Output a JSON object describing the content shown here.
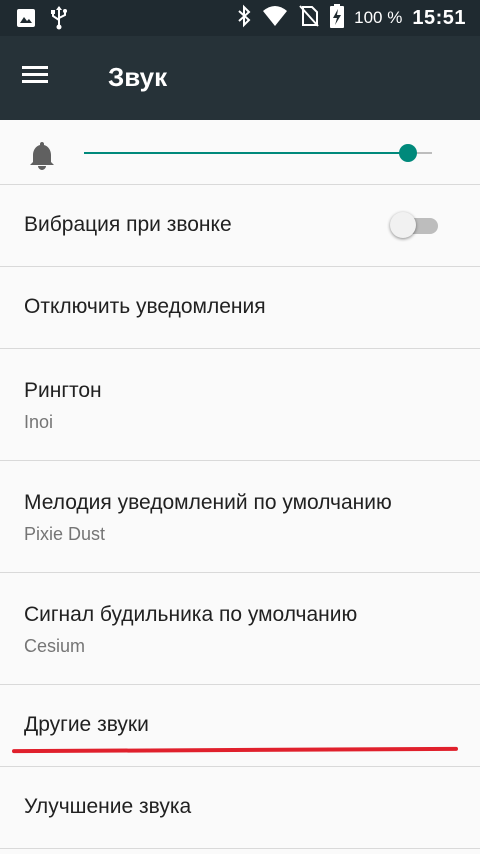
{
  "status_bar": {
    "battery_percent": "100 %",
    "time": "15:51",
    "icons": [
      "image-icon",
      "usb-icon",
      "bluetooth-icon",
      "wifi-icon",
      "no-sim-icon",
      "battery-charging-icon"
    ]
  },
  "toolbar": {
    "menu_icon": "menu-icon",
    "title": "Звук"
  },
  "volume": {
    "icon": "bell-icon",
    "level": 0.93,
    "accent_color": "#00897b"
  },
  "settings": [
    {
      "title": "Вибрация при звонке",
      "toggle": false
    },
    {
      "title": "Отключить уведомления"
    },
    {
      "title": "Рингтон",
      "subtitle": "Inoi"
    },
    {
      "title": "Мелодия уведомлений по умолчанию",
      "subtitle": "Pixie Dust"
    },
    {
      "title": "Сигнал будильника по умолчанию",
      "subtitle": "Cesium"
    },
    {
      "title": "Другие звуки",
      "highlighted": true
    },
    {
      "title": "Улучшение звука"
    }
  ],
  "colors": {
    "status_bar": "#1f2a30",
    "toolbar": "#263238",
    "highlight_underline": "#e0202c"
  }
}
